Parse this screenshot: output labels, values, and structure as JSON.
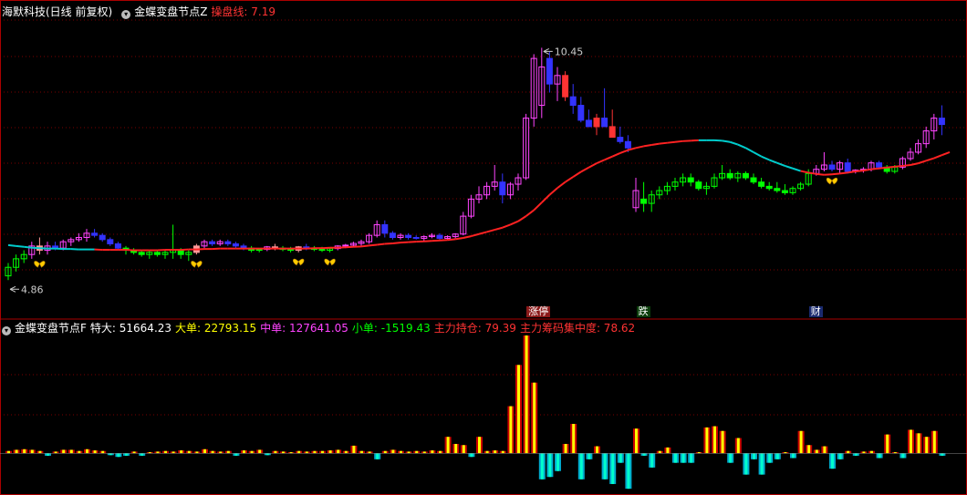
{
  "header": {
    "stock": "海默科技(日线 前复权)",
    "indicator": "金蝶变盘节点Z",
    "line_label": "操盘线: 7.19"
  },
  "sub_header": {
    "indicator": "金蝶变盘节点F",
    "items": [
      {
        "label": "特大: 51664.23",
        "color": "#ffffff"
      },
      {
        "label": "大单: 22793.15",
        "color": "#ffff00"
      },
      {
        "label": "中单: 127641.05",
        "color": "#ff44ff"
      },
      {
        "label": "小单: -1519.43",
        "color": "#00ff00"
      },
      {
        "label": "主力持仓: 79.39",
        "color": "#ff3333"
      },
      {
        "label": "主力筹码集中度: 78.62",
        "color": "#ff3333"
      }
    ]
  },
  "tags": [
    {
      "text": "涨停",
      "bar": 67,
      "bg": "#8b1a1a",
      "color": "#ffffff"
    },
    {
      "text": "跌",
      "bar": 81,
      "bg": "#0c3d0c",
      "color": "#ffffff"
    },
    {
      "text": "财",
      "bar": 103,
      "bg": "#1a2a6e",
      "color": "#ffffff"
    }
  ],
  "icons": [
    "butterfly-icon"
  ],
  "chart_data": [
    {
      "type": "candlestick",
      "annotations": [
        {
          "text": "10.45",
          "bar": 68
        },
        {
          "text": "4.86",
          "bar": 0
        }
      ],
      "butterflies": [
        4,
        24,
        37,
        41,
        105
      ],
      "ylim": [
        4.3,
        11.1
      ],
      "candles": [
        [
          5.1,
          5.4,
          5.0,
          5.3
        ],
        [
          5.3,
          5.6,
          5.2,
          5.5
        ],
        [
          5.5,
          5.7,
          5.4,
          5.6
        ],
        [
          5.6,
          5.9,
          5.5,
          5.8
        ],
        [
          5.8,
          6.0,
          5.6,
          5.7
        ],
        [
          5.7,
          5.9,
          5.6,
          5.8
        ],
        [
          5.8,
          5.9,
          5.7,
          5.75
        ],
        [
          5.75,
          5.95,
          5.7,
          5.9
        ],
        [
          5.9,
          6.0,
          5.8,
          5.95
        ],
        [
          5.95,
          6.1,
          5.9,
          6.0
        ],
        [
          6.0,
          6.2,
          5.9,
          6.1
        ],
        [
          6.1,
          6.2,
          6.0,
          6.05
        ],
        [
          6.05,
          6.1,
          5.9,
          5.95
        ],
        [
          5.95,
          6.0,
          5.8,
          5.85
        ],
        [
          5.85,
          5.9,
          5.7,
          5.75
        ],
        [
          5.75,
          5.8,
          5.6,
          5.7
        ],
        [
          5.7,
          5.75,
          5.6,
          5.65
        ],
        [
          5.65,
          5.7,
          5.55,
          5.6
        ],
        [
          5.6,
          5.7,
          5.5,
          5.65
        ],
        [
          5.65,
          5.7,
          5.55,
          5.6
        ],
        [
          5.6,
          5.7,
          5.5,
          5.65
        ],
        [
          5.65,
          6.3,
          5.5,
          5.7
        ],
        [
          5.7,
          5.75,
          5.5,
          5.6
        ],
        [
          5.6,
          5.7,
          5.45,
          5.65
        ],
        [
          5.65,
          5.85,
          5.6,
          5.8
        ],
        [
          5.8,
          5.95,
          5.75,
          5.9
        ],
        [
          5.9,
          5.95,
          5.8,
          5.85
        ],
        [
          5.85,
          5.95,
          5.8,
          5.9
        ],
        [
          5.9,
          5.95,
          5.8,
          5.85
        ],
        [
          5.85,
          5.9,
          5.75,
          5.8
        ],
        [
          5.8,
          5.85,
          5.7,
          5.75
        ],
        [
          5.75,
          5.8,
          5.65,
          5.7
        ],
        [
          5.7,
          5.75,
          5.65,
          5.72
        ],
        [
          5.72,
          5.8,
          5.68,
          5.78
        ],
        [
          5.78,
          5.85,
          5.7,
          5.75
        ],
        [
          5.75,
          5.8,
          5.68,
          5.72
        ],
        [
          5.72,
          5.78,
          5.65,
          5.7
        ],
        [
          5.7,
          5.8,
          5.65,
          5.78
        ],
        [
          5.78,
          5.85,
          5.7,
          5.75
        ],
        [
          5.75,
          5.8,
          5.68,
          5.72
        ],
        [
          5.72,
          5.78,
          5.66,
          5.7
        ],
        [
          5.7,
          5.76,
          5.65,
          5.74
        ],
        [
          5.74,
          5.82,
          5.7,
          5.8
        ],
        [
          5.8,
          5.85,
          5.75,
          5.82
        ],
        [
          5.82,
          5.9,
          5.78,
          5.86
        ],
        [
          5.86,
          5.95,
          5.8,
          5.9
        ],
        [
          5.9,
          6.1,
          5.85,
          6.05
        ],
        [
          6.05,
          6.4,
          6.0,
          6.3
        ],
        [
          6.3,
          6.4,
          6.0,
          6.1
        ],
        [
          6.1,
          6.15,
          5.95,
          6.0
        ],
        [
          6.0,
          6.1,
          5.95,
          6.05
        ],
        [
          6.05,
          6.1,
          5.95,
          6.0
        ],
        [
          6.0,
          6.05,
          5.95,
          5.98
        ],
        [
          5.98,
          6.05,
          5.9,
          6.02
        ],
        [
          6.02,
          6.1,
          5.98,
          6.05
        ],
        [
          6.05,
          6.1,
          5.95,
          5.98
        ],
        [
          5.98,
          6.05,
          5.95,
          6.02
        ],
        [
          6.02,
          6.1,
          5.98,
          6.08
        ],
        [
          6.08,
          6.6,
          6.05,
          6.5
        ],
        [
          6.5,
          7.0,
          6.45,
          6.9
        ],
        [
          6.9,
          7.2,
          6.8,
          7.0
        ],
        [
          7.0,
          7.3,
          6.9,
          7.2
        ],
        [
          7.2,
          7.7,
          7.1,
          7.3
        ],
        [
          7.3,
          7.5,
          6.8,
          7.0
        ],
        [
          7.0,
          7.3,
          6.9,
          7.25
        ],
        [
          7.25,
          7.5,
          7.1,
          7.4
        ],
        [
          7.4,
          8.9,
          7.35,
          8.8
        ],
        [
          8.8,
          10.3,
          8.6,
          10.2
        ],
        [
          9.1,
          10.45,
          8.8,
          10.0
        ],
        [
          10.2,
          10.35,
          9.4,
          9.6
        ],
        [
          9.6,
          10.0,
          9.2,
          9.8
        ],
        [
          9.8,
          9.9,
          9.2,
          9.3
        ],
        [
          9.3,
          9.6,
          8.9,
          9.1
        ],
        [
          9.1,
          9.3,
          8.7,
          8.75
        ],
        [
          8.75,
          9.0,
          8.6,
          8.6
        ],
        [
          8.6,
          8.9,
          8.4,
          8.8
        ],
        [
          8.8,
          9.5,
          8.6,
          8.6
        ],
        [
          8.6,
          9.0,
          8.4,
          8.35
        ],
        [
          8.35,
          8.6,
          8.2,
          8.25
        ],
        [
          8.25,
          8.4,
          8.0,
          8.1
        ],
        [
          6.7,
          7.4,
          6.6,
          7.1
        ],
        [
          6.9,
          7.3,
          6.6,
          6.8
        ],
        [
          6.8,
          7.1,
          6.6,
          7.0
        ],
        [
          7.0,
          7.2,
          6.9,
          7.1
        ],
        [
          7.1,
          7.3,
          7.0,
          7.2
        ],
        [
          7.2,
          7.4,
          7.1,
          7.3
        ],
        [
          7.3,
          7.5,
          7.2,
          7.4
        ],
        [
          7.4,
          7.5,
          7.2,
          7.3
        ],
        [
          7.3,
          7.35,
          7.1,
          7.15
        ],
        [
          7.15,
          7.3,
          7.0,
          7.2
        ],
        [
          7.2,
          7.5,
          7.15,
          7.4
        ],
        [
          7.4,
          7.7,
          7.35,
          7.5
        ],
        [
          7.5,
          7.6,
          7.35,
          7.4
        ],
        [
          7.4,
          7.55,
          7.3,
          7.5
        ],
        [
          7.5,
          7.55,
          7.35,
          7.4
        ],
        [
          7.4,
          7.5,
          7.25,
          7.3
        ],
        [
          7.3,
          7.4,
          7.15,
          7.2
        ],
        [
          7.2,
          7.3,
          7.1,
          7.15
        ],
        [
          7.15,
          7.3,
          7.05,
          7.1
        ],
        [
          7.1,
          7.25,
          7.0,
          7.05
        ],
        [
          7.05,
          7.2,
          7.0,
          7.15
        ],
        [
          7.15,
          7.3,
          7.1,
          7.25
        ],
        [
          7.25,
          7.6,
          7.2,
          7.5
        ],
        [
          7.5,
          7.7,
          7.45,
          7.6
        ],
        [
          7.6,
          8.0,
          7.55,
          7.7
        ],
        [
          7.7,
          7.8,
          7.55,
          7.6
        ],
        [
          7.6,
          7.8,
          7.5,
          7.75
        ],
        [
          7.75,
          7.85,
          7.5,
          7.55
        ],
        [
          7.55,
          7.6,
          7.5,
          7.58
        ],
        [
          7.58,
          7.65,
          7.52,
          7.6
        ],
        [
          7.6,
          7.8,
          7.55,
          7.75
        ],
        [
          7.75,
          7.8,
          7.6,
          7.65
        ],
        [
          7.65,
          7.7,
          7.5,
          7.55
        ],
        [
          7.55,
          7.7,
          7.5,
          7.65
        ],
        [
          7.65,
          7.9,
          7.6,
          7.85
        ],
        [
          7.85,
          8.1,
          7.8,
          8.0
        ],
        [
          8.0,
          8.3,
          7.95,
          8.2
        ],
        [
          8.2,
          8.6,
          8.1,
          8.5
        ],
        [
          8.5,
          8.9,
          8.3,
          8.8
        ],
        [
          8.8,
          9.1,
          8.4,
          8.65
        ]
      ],
      "ma": [
        5.82,
        5.8,
        5.78,
        5.76,
        5.75,
        5.74,
        5.74,
        5.73,
        5.73,
        5.72,
        5.72,
        5.72,
        5.71,
        5.71,
        5.71,
        5.71,
        5.7,
        5.7,
        5.7,
        5.7,
        5.71,
        5.71,
        5.71,
        5.72,
        5.72,
        5.73,
        5.73,
        5.74,
        5.74,
        5.74,
        5.74,
        5.74,
        5.74,
        5.74,
        5.74,
        5.74,
        5.74,
        5.74,
        5.74,
        5.75,
        5.75,
        5.76,
        5.76,
        5.77,
        5.78,
        5.79,
        5.81,
        5.83,
        5.85,
        5.86,
        5.88,
        5.89,
        5.9,
        5.91,
        5.92,
        5.93,
        5.94,
        5.96,
        5.99,
        6.03,
        6.08,
        6.13,
        6.18,
        6.23,
        6.3,
        6.38,
        6.5,
        6.64,
        6.82,
        7.0,
        7.16,
        7.3,
        7.42,
        7.54,
        7.64,
        7.74,
        7.82,
        7.9,
        7.98,
        8.05,
        8.1,
        8.14,
        8.17,
        8.2,
        8.22,
        8.24,
        8.26,
        8.27,
        8.28,
        8.28,
        8.28,
        8.27,
        8.24,
        8.18,
        8.1,
        8.0,
        7.9,
        7.82,
        7.75,
        7.68,
        7.62,
        7.56,
        7.52,
        7.49,
        7.47,
        7.48,
        7.5,
        7.52,
        7.55,
        7.57,
        7.6,
        7.62,
        7.64,
        7.66,
        7.68,
        7.7,
        7.74,
        7.8,
        7.86,
        7.93,
        8.0
      ],
      "ma_down_color": "#00cccc",
      "ma_up_color": "#ff2222"
    },
    {
      "type": "bar",
      "ylim": [
        -3.3,
        10
      ],
      "values": [
        0.2,
        0.3,
        0.35,
        0.3,
        0.2,
        -0.2,
        0.15,
        0.3,
        0.3,
        0.2,
        0.35,
        0.25,
        0.2,
        -0.15,
        -0.3,
        -0.2,
        0.15,
        -0.2,
        0.1,
        0.15,
        0.2,
        0.15,
        0.25,
        0.2,
        0.15,
        0.35,
        0.2,
        0.15,
        0.2,
        -0.2,
        0.25,
        0.2,
        0.3,
        -0.15,
        0.2,
        0.15,
        0.1,
        0.2,
        0.15,
        0.2,
        0.2,
        0.25,
        0.3,
        0.2,
        0.65,
        0.2,
        0.15,
        -0.5,
        0.2,
        0.3,
        0.2,
        0.15,
        0.2,
        0.15,
        0.25,
        0.2,
        1.4,
        0.8,
        0.7,
        -0.3,
        1.4,
        0.2,
        0.25,
        0.2,
        4.0,
        7.5,
        10.0,
        6.0,
        -2.2,
        -2.0,
        -1.5,
        0.8,
        2.5,
        -2.2,
        -0.5,
        0.6,
        -2.2,
        -2.6,
        -0.8,
        -3.0,
        2.1,
        -0.2,
        -1.2,
        0.2,
        0.5,
        -0.8,
        -0.8,
        -0.8,
        0.1,
        2.2,
        2.3,
        1.9,
        -0.8,
        1.3,
        -1.8,
        -0.5,
        -1.8,
        -0.8,
        -0.5,
        0.1,
        -0.4,
        1.9,
        0.7,
        0.3,
        0.6,
        -1.3,
        -0.5,
        0.2,
        -0.2,
        0.15,
        0.2,
        -0.4,
        1.6,
        0.1,
        -0.4,
        2.0,
        1.7,
        1.4,
        1.9,
        -0.2
      ],
      "pos_colors": [
        "#cc0000",
        "#ffff00"
      ],
      "neg_colors": [
        "#00aacc",
        "#00ffcc"
      ]
    }
  ]
}
